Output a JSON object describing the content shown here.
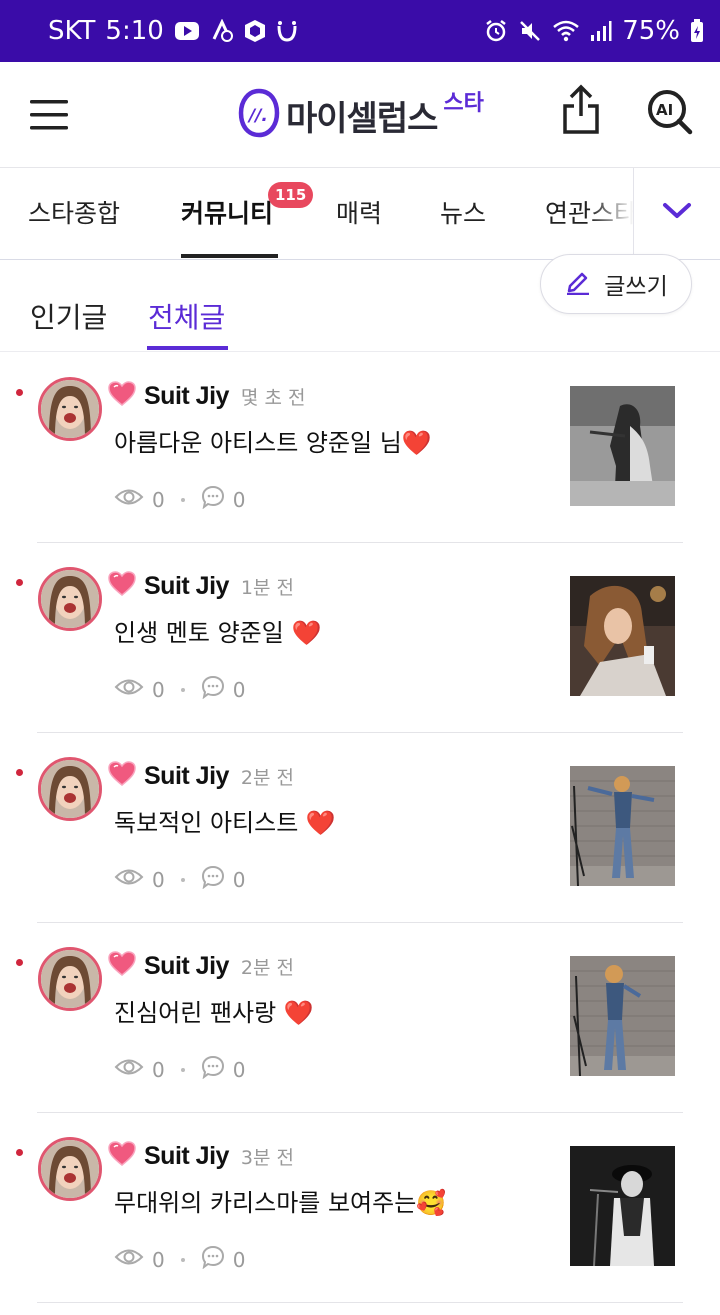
{
  "status_bar": {
    "carrier": "SKT",
    "time": "5:10",
    "battery": "75%",
    "left_icons": [
      "youtube-icon",
      "data-saver-icon",
      "box-app-icon",
      "smile-app-icon"
    ],
    "right_icons": [
      "alarm-icon",
      "mute-icon",
      "wifi-icon",
      "signal-icon",
      "battery-icon"
    ]
  },
  "header": {
    "logo_text": "마이셀럽스",
    "logo_sup": "스타",
    "brand_color": "#5b2bd6"
  },
  "category_tabs": {
    "items": [
      "스타종합",
      "커뮤니티",
      "매력",
      "뉴스",
      "연관스타"
    ],
    "active_index": 1,
    "badge": "115"
  },
  "sub_tabs": {
    "items": [
      "인기글",
      "전체글"
    ],
    "active_index": 1,
    "write_label": "글쓰기"
  },
  "posts": [
    {
      "author": "Suit Jiy",
      "time": "몇 초 전",
      "title": "아름다운 아티스트 양준일 님",
      "emoji": "❤️",
      "views": "0",
      "comments": "0"
    },
    {
      "author": "Suit Jiy",
      "time": "1분 전",
      "title": "인생 멘토 양준일",
      "emoji": "❤️",
      "views": "0",
      "comments": "0"
    },
    {
      "author": "Suit Jiy",
      "time": "2분 전",
      "title": "독보적인 아티스트",
      "emoji": "❤️",
      "views": "0",
      "comments": "0"
    },
    {
      "author": "Suit Jiy",
      "time": "2분 전",
      "title": "진심어린 팬사랑",
      "emoji": "❤️",
      "views": "0",
      "comments": "0"
    },
    {
      "author": "Suit Jiy",
      "time": "3분 전",
      "title": "무대위의 카리스마를 보여주는",
      "emoji": "🥰",
      "views": "0",
      "comments": "0"
    }
  ],
  "colors": {
    "status_bar": "#3a0ca8",
    "accent": "#5b2bd6",
    "badge": "#e8485e",
    "new_dot": "#d0263d"
  }
}
